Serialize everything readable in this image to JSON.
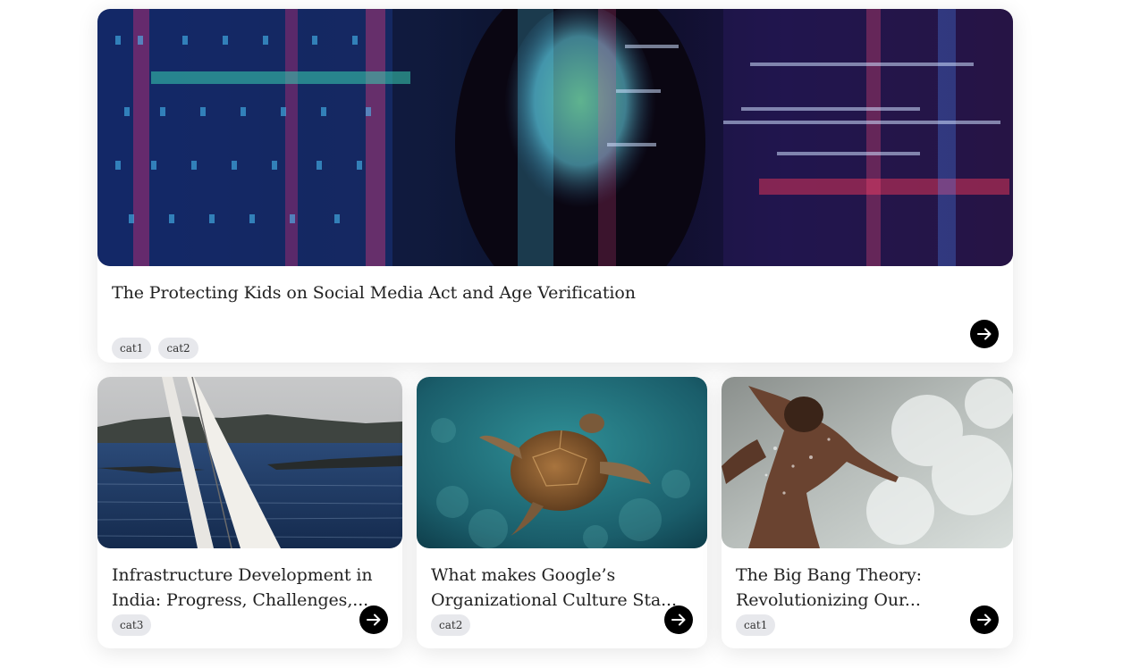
{
  "featured": {
    "title": "The Protecting Kids on Social Media Act and Age Verification",
    "tags": [
      "cat1",
      "cat2"
    ],
    "image_icon": "woman-code-projection-photo"
  },
  "cards": [
    {
      "title": "Infrastructure Development in India: Progress, Challenges,...",
      "tags": [
        "cat3"
      ],
      "image_icon": "sailboat-photo"
    },
    {
      "title": "What makes Google’s Organizational Culture Sta...",
      "tags": [
        "cat2"
      ],
      "image_icon": "sea-turtle-photo"
    },
    {
      "title": "The Big Bang Theory: Revolutionizing Our...",
      "tags": [
        "cat1"
      ],
      "image_icon": "surfer-photo"
    }
  ],
  "icons": {
    "arrow": "arrow-right-icon"
  },
  "colors": {
    "button": "#000000",
    "tag_bg": "#e7e8ec",
    "title": "#222222"
  }
}
